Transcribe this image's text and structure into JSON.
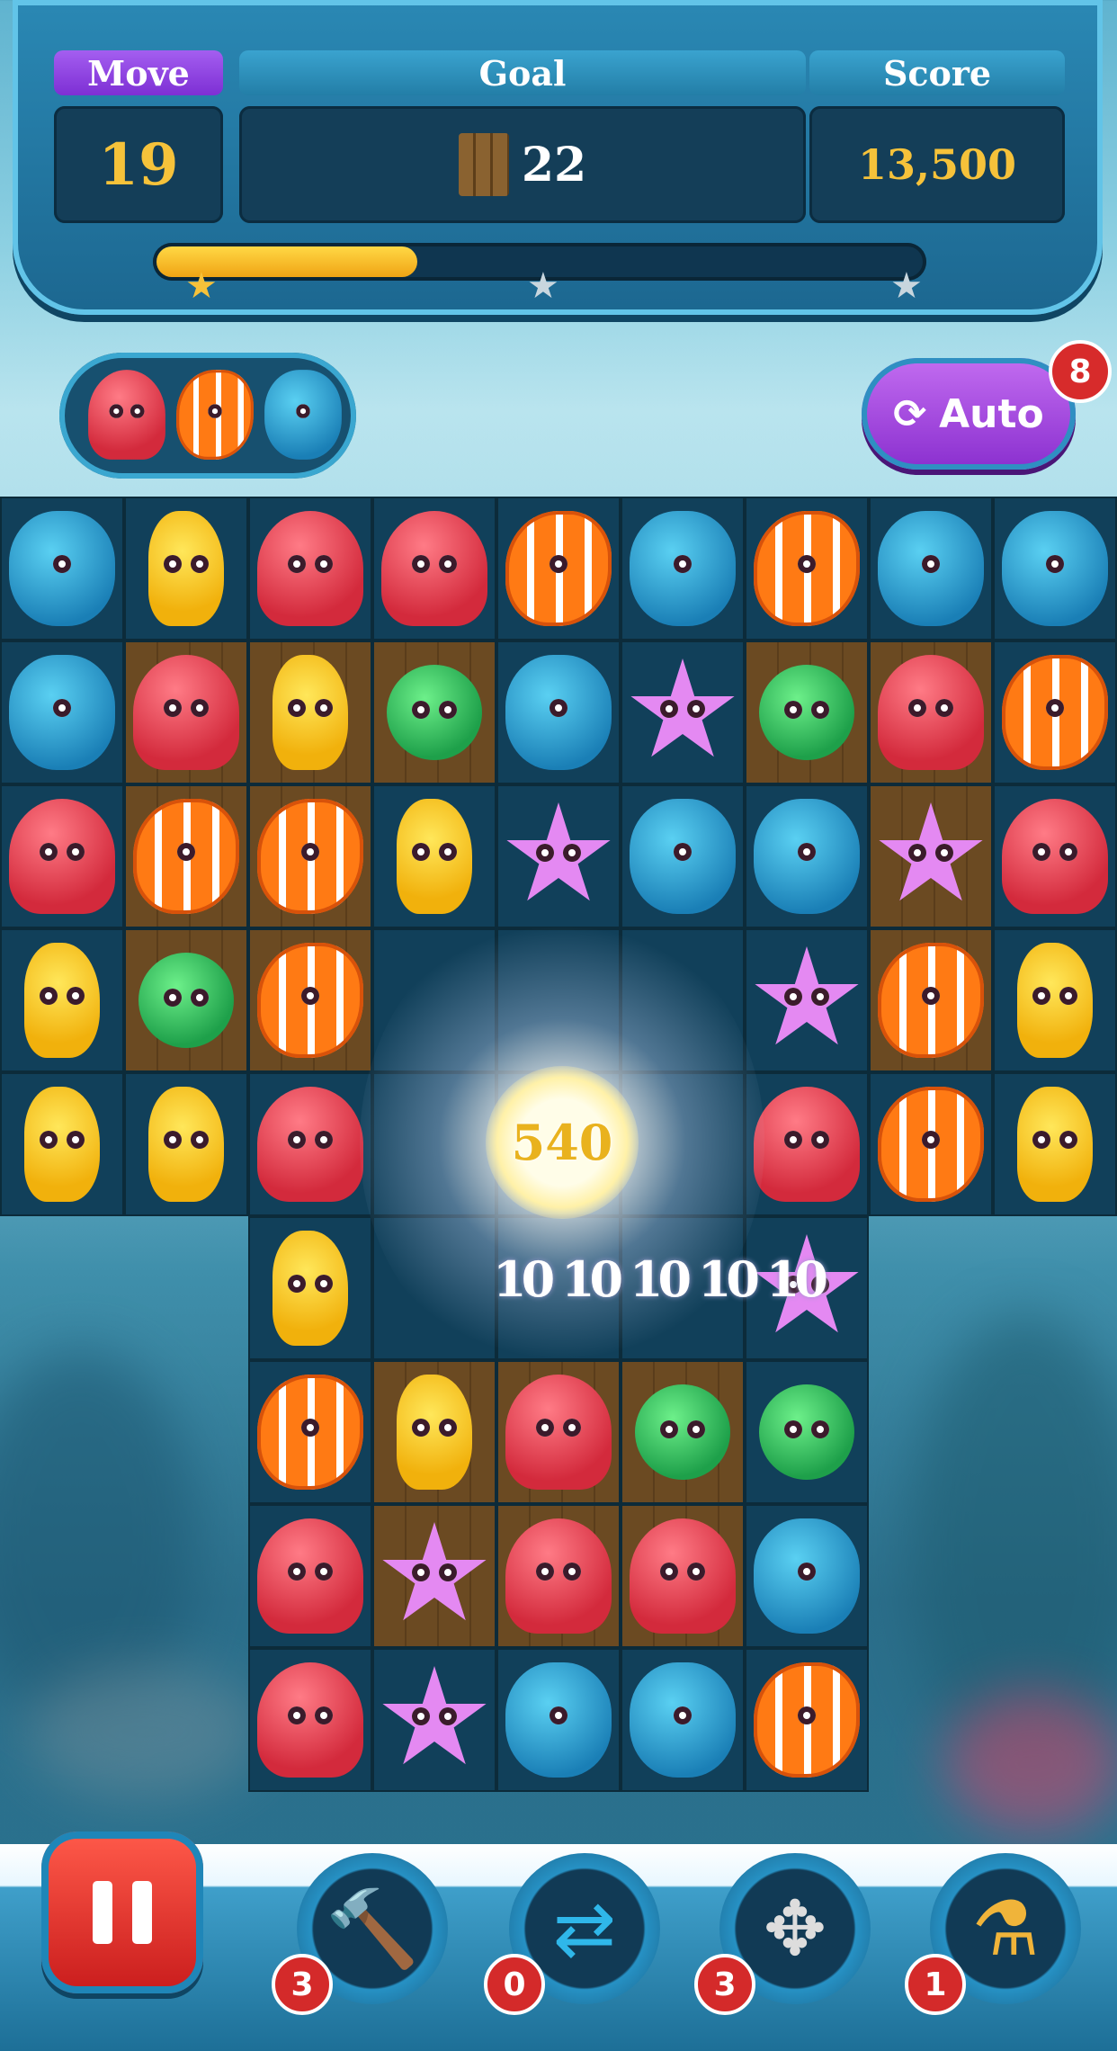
{
  "hud": {
    "move_label": "Move",
    "move_value": "19",
    "goal_label": "Goal",
    "goal_value": "22",
    "goal_icon": "wood-plank-icon",
    "score_label": "Score",
    "score_value": "13,500",
    "progress_fraction": 0.34,
    "stars_earned": 1,
    "stars_total": 3
  },
  "targets": [
    "octopus",
    "fish",
    "dolphin"
  ],
  "auto": {
    "label": "Auto",
    "badge": "8",
    "icon": "refresh-icon"
  },
  "board": {
    "rows": [
      [
        "dolphin",
        "seahorse",
        "octopus",
        "octopus",
        "fish",
        "dolphin",
        "fish",
        "dolphin",
        "dolphin"
      ],
      [
        "dolphin",
        "octopus",
        "seahorse",
        "puffer",
        "dolphin",
        "star",
        "puffer",
        "octopus",
        "fish"
      ],
      [
        "octopus",
        "fish",
        "fish",
        "seahorse",
        "star",
        "dolphin",
        "dolphin",
        "star",
        "octopus"
      ],
      [
        "seahorse",
        "puffer",
        "fish",
        "",
        "",
        "",
        "star",
        "fish",
        "seahorse"
      ],
      [
        "seahorse",
        "seahorse",
        "octopus",
        "",
        "",
        "",
        "octopus",
        "fish",
        "seahorse"
      ],
      [
        null,
        null,
        "seahorse",
        "",
        "",
        "",
        "star",
        null,
        null
      ],
      [
        null,
        null,
        "fish",
        "seahorse",
        "octopus",
        "puffer",
        "puffer",
        null,
        null
      ],
      [
        null,
        null,
        "octopus",
        "star",
        "octopus",
        "octopus",
        "dolphin",
        null,
        null
      ],
      [
        null,
        null,
        "octopus",
        "star",
        "dolphin",
        "dolphin",
        "fish",
        null,
        null
      ]
    ],
    "wood_cells": [
      "1-1",
      "1-2",
      "1-3",
      "1-6",
      "1-7",
      "2-1",
      "2-2",
      "2-7",
      "3-1",
      "3-2",
      "3-7",
      "6-3",
      "6-4",
      "6-5",
      "7-3",
      "7-4",
      "7-5"
    ]
  },
  "effects": {
    "burst_points": "540",
    "row_points": "10 10 10 10 10"
  },
  "toolbar": {
    "pause": "pause-icon",
    "tools": [
      {
        "name": "hammer-icon",
        "count": "3"
      },
      {
        "name": "shuffle-icon",
        "count": "0"
      },
      {
        "name": "bomb-icon",
        "count": "3"
      },
      {
        "name": "rainbow-potion-icon",
        "count": "1"
      }
    ]
  }
}
